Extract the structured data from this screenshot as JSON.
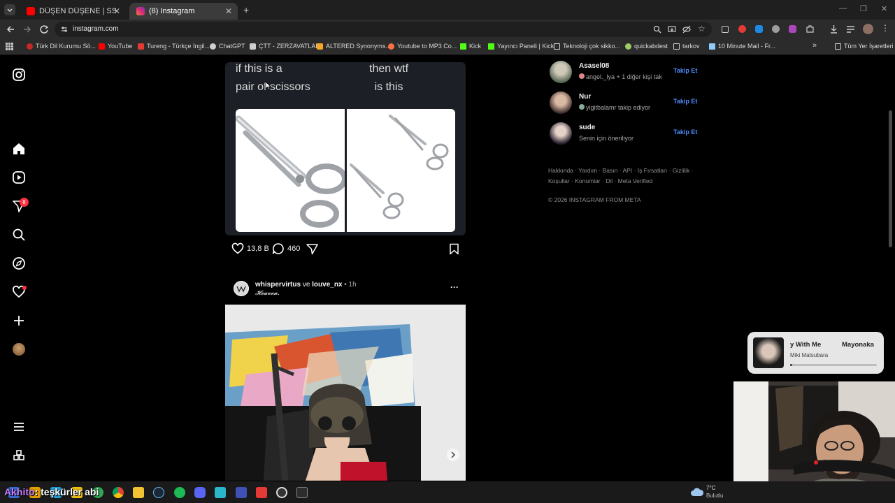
{
  "browser": {
    "tabs": [
      {
        "title": "DÜŞEN DÜŞENE | SSriders | Mo",
        "favicon_color": "#ff0000"
      },
      {
        "title": "(8) Instagram",
        "favicon_color": "#dd2a7b"
      }
    ],
    "new_tab": "+",
    "address": "instagram.com",
    "bookmarks": [
      {
        "label": "Türk Dil Kurumu Sö...",
        "color": "#c62828"
      },
      {
        "label": "YouTube",
        "color": "#ff0000"
      },
      {
        "label": "Tureng - Türkçe İngil...",
        "color": "#e53935"
      },
      {
        "label": "ChatGPT",
        "color": "#cfcfcf"
      },
      {
        "label": "ÇTT - ZERZAVATLAR",
        "color": "#cfcfcf"
      },
      {
        "label": "ALTERED Synonyms...",
        "color": "#f9a825"
      },
      {
        "label": "Youtube to MP3 Co...",
        "color": "#ff7043"
      },
      {
        "label": "Kick",
        "color": "#53fc18"
      },
      {
        "label": "Yayıncı Paneli | Kick",
        "color": "#53fc18"
      },
      {
        "label": "Teknoloji çok sikko...",
        "color": "#cfcfcf"
      },
      {
        "label": "quickabdest",
        "color": "#9ccc65"
      },
      {
        "label": "tarkov",
        "color": "#cfcfcf"
      },
      {
        "label": "10 Minute Mail - Fr...",
        "color": "#90caf9"
      }
    ],
    "all_bookmarks": "Tüm Yer İşaretleri"
  },
  "instagram": {
    "notification_count": "8",
    "post1": {
      "meme_left": [
        "if this is a",
        "pair of scissors"
      ],
      "meme_right": [
        "then wtf",
        "is this"
      ],
      "likes": "13,8 B",
      "comments": "460"
    },
    "post2": {
      "author": "whispervirtus",
      "joiner": "ve",
      "coauthor": "louve_nx",
      "time": "• 1h",
      "caption": "𝓗𝓮𝓪𝓿𝓮𝓷.",
      "more": "···"
    },
    "suggestions": [
      {
        "name": "Asasel08",
        "sub": "angel._lya + 1 diğer kişi tak",
        "follow": "Takip Et"
      },
      {
        "name": "Nur",
        "sub": "yigitbalamr takip ediyor",
        "follow": "Takip Et"
      },
      {
        "name": "sude",
        "sub": "Senin için öneriliyor",
        "follow": "Takip Et"
      }
    ],
    "footer_line1": "Hakkında · Yardım · Basın · API · İş Fırsatları · Gizlilik ·",
    "footer_line2": "Koşullar · Konumlar · Dil · Meta Verified",
    "copyright": "© 2026 INSTAGRAM FROM META"
  },
  "now_playing": {
    "title": "y With Me",
    "artist": "Miki Matsubara",
    "right_title": "Mayonaka"
  },
  "taskbar": {
    "temperature": "7°C",
    "weather": "Bulutlu"
  },
  "stream_overlay": {
    "user": "Akhito",
    "message": ": teşkürler abi"
  }
}
